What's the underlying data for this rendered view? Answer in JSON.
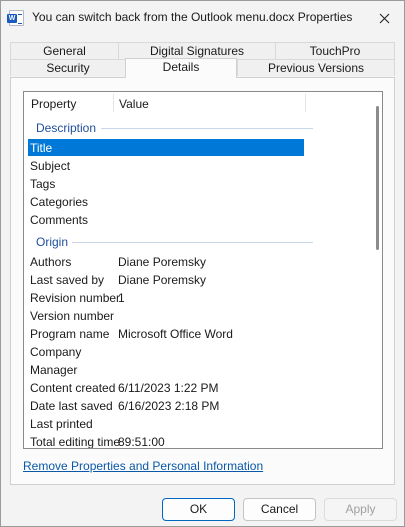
{
  "window": {
    "title": "You can switch back from the Outlook menu.docx Properties",
    "app_icon": "word-document-icon",
    "close_icon": "close-icon"
  },
  "tabs": {
    "row1": [
      "General",
      "Digital Signatures",
      "TouchPro"
    ],
    "row2": [
      "Security",
      "Details",
      "Previous Versions"
    ],
    "active": "Details"
  },
  "list": {
    "columns": {
      "property": "Property",
      "value": "Value"
    },
    "groups": {
      "description": "Description",
      "origin": "Origin"
    },
    "description_rows": [
      {
        "property": "Title",
        "value": ""
      },
      {
        "property": "Subject",
        "value": ""
      },
      {
        "property": "Tags",
        "value": ""
      },
      {
        "property": "Categories",
        "value": ""
      },
      {
        "property": "Comments",
        "value": ""
      }
    ],
    "origin_rows": [
      {
        "property": "Authors",
        "value": "Diane Poremsky"
      },
      {
        "property": "Last saved by",
        "value": "Diane Poremsky"
      },
      {
        "property": "Revision number",
        "value": "1"
      },
      {
        "property": "Version number",
        "value": ""
      },
      {
        "property": "Program name",
        "value": "Microsoft Office Word"
      },
      {
        "property": "Company",
        "value": ""
      },
      {
        "property": "Manager",
        "value": ""
      },
      {
        "property": "Content created",
        "value": "6/11/2023 1:22 PM"
      },
      {
        "property": "Date last saved",
        "value": "6/16/2023 2:18 PM"
      },
      {
        "property": "Last printed",
        "value": ""
      },
      {
        "property": "Total editing time",
        "value": "89:51:00"
      }
    ],
    "selected_row": "Title"
  },
  "link": {
    "label": "Remove Properties and Personal Information"
  },
  "buttons": {
    "ok": "OK",
    "cancel": "Cancel",
    "apply": "Apply"
  },
  "colors": {
    "selection": "#0078d7",
    "group_text": "#1f4e9c",
    "link": "#0a58a8"
  }
}
